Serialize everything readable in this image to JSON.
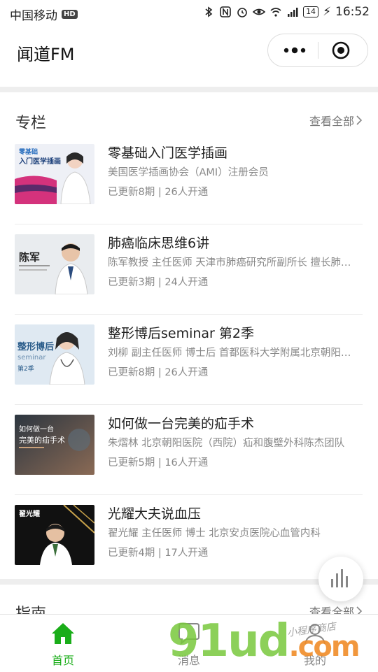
{
  "status_bar": {
    "carrier": "中国移动",
    "hd": "HD",
    "network": "4G",
    "battery": "14",
    "time": "16:52"
  },
  "header": {
    "title": "闻道FM",
    "more_icon": "more-dots-icon",
    "close_icon": "target-close-icon"
  },
  "columns_section": {
    "title": "专栏",
    "view_all": "查看全部",
    "items": [
      {
        "title": "零基础入门医学插画",
        "subtitle": "美国医学插画协会（AMI）注册会员",
        "meta": "已更新8期 | 26人开通",
        "thumb_text": "入门医学插画",
        "thumb_bg": "#eef0f6",
        "thumb_accent": "#d4327c"
      },
      {
        "title": "肺癌临床思维6讲",
        "subtitle": "陈军教授 主任医师 天津市肺癌研究所副所长 擅长肺…",
        "meta": "已更新3期 | 24人开通",
        "thumb_text": "陈军",
        "thumb_bg": "#e9ecef",
        "thumb_accent": "#222222"
      },
      {
        "title": "整形博后seminar 第2季",
        "subtitle": "刘柳 副主任医师 博士后 首都医科大学附属北京朝阳…",
        "meta": "已更新8期 | 26人开通",
        "thumb_text": "整形博后",
        "thumb_bg": "#dfe9f2",
        "thumb_accent": "#2a5c8a"
      },
      {
        "title": "如何做一台完美的疝手术",
        "subtitle": "朱熠林 北京朝阳医院（西院）疝和腹壁外科陈杰团队",
        "meta": "已更新5期 | 16人开通",
        "thumb_text": "如何做一台完美的疝手术",
        "thumb_bg": "#3e4a55",
        "thumb_accent": "#c9a07a"
      },
      {
        "title": "光耀大夫说血压",
        "subtitle": "翟光耀 主任医师 博士 北京安贞医院心血管内科",
        "meta": "已更新4期 | 17人开通",
        "thumb_text": "翟光耀",
        "thumb_bg": "#111111",
        "thumb_accent": "#c8a24a"
      }
    ]
  },
  "guide_section": {
    "title": "指南",
    "view_all": "查看全部"
  },
  "floating_button": {
    "icon": "audio-bars-icon"
  },
  "tabbar": {
    "tabs": [
      {
        "label": "首页",
        "icon": "home-icon",
        "active": true
      },
      {
        "label": "消息",
        "icon": "message-icon",
        "active": false
      },
      {
        "label": "我的",
        "icon": "user-icon",
        "active": false
      }
    ],
    "active_color": "#1aad19"
  },
  "watermark": {
    "main": "91ud",
    "domain": ".com",
    "small": "小程序商店"
  }
}
